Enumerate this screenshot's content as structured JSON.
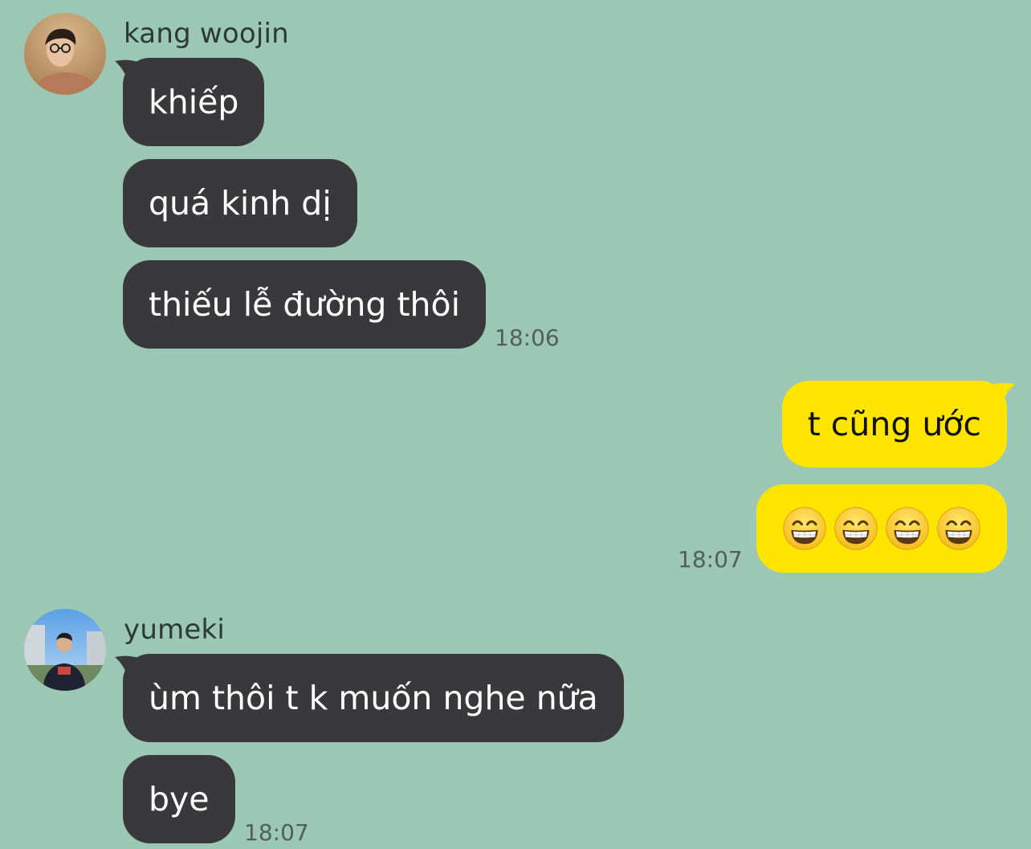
{
  "app": {
    "colors": {
      "background": "#9dc7b5",
      "incoming_bubble": "#39393c",
      "outgoing_bubble": "#fee500"
    }
  },
  "messages": {
    "group1": {
      "sender": "kang woojin",
      "avatar_icon": "person-avatar-photo",
      "lines": [
        "khiếp",
        "quá kinh dị",
        "thiếu lễ đường thôi"
      ],
      "time": "18:06"
    },
    "outgoing": {
      "lines": [
        "t cũng ước",
        "😁😁😁😁"
      ],
      "emoji_icon": "grinning-face-with-smiling-eyes-icon",
      "emoji_count": 4,
      "time": "18:07"
    },
    "group2": {
      "sender": "yumeki",
      "avatar_icon": "person-avatar-photo",
      "lines": [
        "ùm thôi t k muốn nghe nữa",
        "bye"
      ],
      "time": "18:07"
    }
  }
}
